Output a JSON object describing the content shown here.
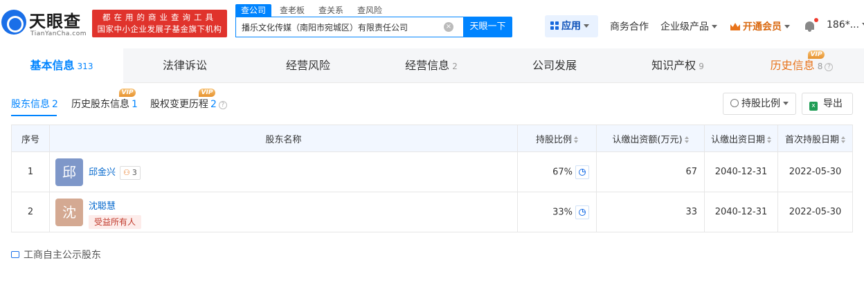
{
  "header": {
    "logo_text": "天眼查",
    "logo_sub": "TianYanCha.com",
    "slogan_line1": "都在用的商业查询工具",
    "slogan_line2": "国家中小企业发展子基金旗下机构",
    "search_tabs": [
      "查公司",
      "查老板",
      "查关系",
      "查风险"
    ],
    "search_value": "播乐文化传媒（南阳市宛城区）有限责任公司",
    "search_button": "天眼一下",
    "apps_label": "应用",
    "nav": [
      "商务合作",
      "企业级产品"
    ],
    "vip_label": "开通会员",
    "user_label": "186*..."
  },
  "main_tabs": [
    {
      "label": "基本信息",
      "count": "313"
    },
    {
      "label": "法律诉讼",
      "count": ""
    },
    {
      "label": "经营风险",
      "count": ""
    },
    {
      "label": "经营信息",
      "count": "2"
    },
    {
      "label": "公司发展",
      "count": ""
    },
    {
      "label": "知识产权",
      "count": "9"
    },
    {
      "label": "历史信息",
      "count": "8"
    }
  ],
  "vip_text": "VIP",
  "sub_tabs": [
    {
      "label": "股东信息",
      "count": "2"
    },
    {
      "label": "历史股东信息",
      "count": "1"
    },
    {
      "label": "股权变更历程",
      "count": "2"
    }
  ],
  "toolbar": {
    "ratio_button": "持股比例",
    "export_button": "导出"
  },
  "table": {
    "headers": [
      "序号",
      "股东名称",
      "持股比例",
      "认缴出资额(万元)",
      "认缴出资日期",
      "首次持股日期"
    ],
    "rows": [
      {
        "index": "1",
        "avatar": "邱",
        "avatar_color": "#7e97c9",
        "name": "邱金兴",
        "relation_count": "3",
        "tag": "",
        "ratio": "67%",
        "capital": "67",
        "subscribe_date": "2040-12-31",
        "first_date": "2022-05-30"
      },
      {
        "index": "2",
        "avatar": "沈",
        "avatar_color": "#d4a992",
        "name": "沈聪慧",
        "relation_count": "",
        "tag": "受益所有人",
        "ratio": "33%",
        "capital": "33",
        "subscribe_date": "2040-12-31",
        "first_date": "2022-05-30"
      }
    ]
  },
  "footnote": "工商自主公示股东",
  "colors": {
    "primary": "#0084ff",
    "brand_red": "#e0332c",
    "vip_orange": "#e8731a"
  }
}
